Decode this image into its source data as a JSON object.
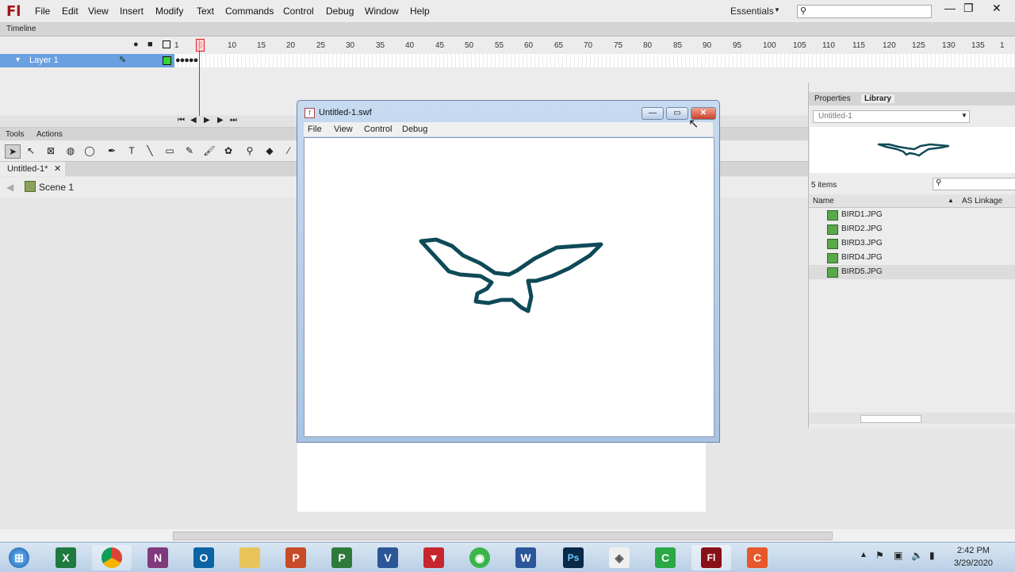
{
  "app": {
    "logo": "Fl"
  },
  "menu": [
    "File",
    "Edit",
    "View",
    "Insert",
    "Modify",
    "Text",
    "Commands",
    "Control",
    "Debug",
    "Window",
    "Help"
  ],
  "workspace": "Essentials",
  "timeline": {
    "label": "Timeline",
    "layer": "Layer 1",
    "ticks": [
      "1",
      "5",
      "10",
      "15",
      "20",
      "25",
      "30",
      "35",
      "40",
      "45",
      "50",
      "55",
      "60",
      "65",
      "70",
      "75",
      "80",
      "85",
      "90",
      "95",
      "100",
      "105",
      "110",
      "115",
      "120",
      "125",
      "130",
      "135",
      "1"
    ]
  },
  "tools": {
    "tabs": [
      "Tools",
      "Actions"
    ]
  },
  "doc": {
    "tab": "Untitled-1*",
    "scene": "Scene 1"
  },
  "swf": {
    "title": "Untitled-1.swf",
    "menu": [
      "File",
      "View",
      "Control",
      "Debug"
    ]
  },
  "panel": {
    "tabs": [
      "Properties",
      "Library"
    ],
    "library_select": "Untitled-1",
    "items_count": "5 items",
    "col_name": "Name",
    "col_linkage": "AS Linkage",
    "items": [
      "BIRD1.JPG",
      "BIRD2.JPG",
      "BIRD3.JPG",
      "BIRD4.JPG",
      "BIRD5.JPG"
    ]
  },
  "clock": {
    "time": "2:42 PM",
    "date": "3/29/2020"
  },
  "bird_color": "#0e4a58"
}
